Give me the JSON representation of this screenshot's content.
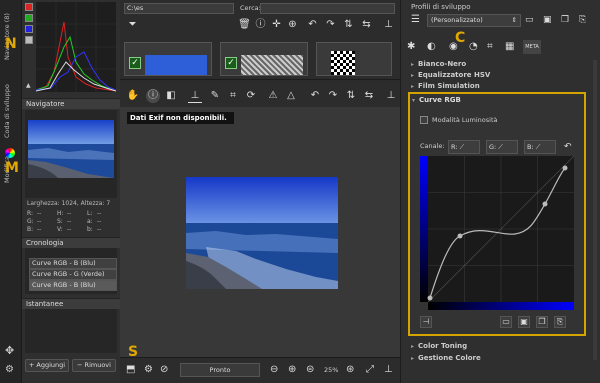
{
  "vtabs": {
    "navigator": "Navigatore (8)",
    "queue": "Coda di sviluppo",
    "modify": "Modifica",
    "marker_n": "N",
    "marker_m": "M",
    "marker_s": "S"
  },
  "navigator": {
    "title": "Navigatore",
    "size_label": "Larghezza: 1024, Altezza: 7",
    "rows": [
      [
        "R:",
        "--",
        "H:",
        "--",
        "L:",
        "--"
      ],
      [
        "G:",
        "--",
        "S:",
        "--",
        "a:",
        "--"
      ],
      [
        "B:",
        "--",
        "V:",
        "--",
        "b:",
        "--"
      ]
    ]
  },
  "history": {
    "title": "Cronologia",
    "items": [
      "Curve RGB - B (Blu)",
      "Curve RGB - G (Verde)",
      "Curve RGB - B (Blu)"
    ]
  },
  "snapshots": {
    "title": "Istantanee",
    "add": "Aggiungi",
    "remove": "Rimuovi"
  },
  "browser": {
    "path": "C:\\es",
    "search_label": "Cerca:",
    "search_value": ""
  },
  "preview": {
    "tooltip": "Dati Exif non disponibili.",
    "status": "Pronto",
    "zoom": "25%"
  },
  "profiles": {
    "title": "Profili di sviluppo",
    "selected": "(Personalizzato)"
  },
  "tools": {
    "meta_tab": "META",
    "marker_c": "C",
    "items_top": [
      "Bianco-Nero",
      "Equalizzatore HSV",
      "Film Simulation"
    ],
    "curve_title": "Curve RGB",
    "luminosity": "Modalità Luminosità",
    "channel_label": "Canale:",
    "channels": [
      "R:",
      "G:",
      "B:"
    ],
    "items_bottom": [
      "Color Toning",
      "Gestione Colore"
    ]
  },
  "colors": {
    "accent": "#d4a500",
    "curve_bg": "#1a1a1a"
  }
}
